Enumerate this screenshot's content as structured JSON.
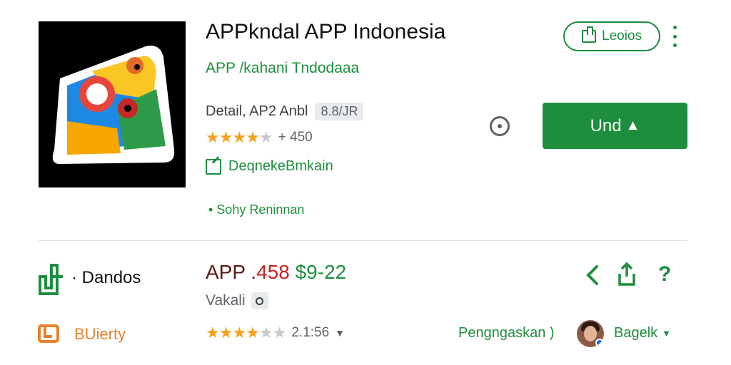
{
  "app": {
    "title": "APPkndal  APP Indonesia",
    "developer": "APP /kahani Tndodaaa",
    "meta_text": "Detail, AP2 Anbl",
    "meta_chip": "8.8/JR",
    "rating_count": "+ 450",
    "wishlist_label": "DeqnekeBmkain",
    "bullet_text": "• Sohy Reninnan",
    "stars_filled": 3.5
  },
  "actions": {
    "library_label": "Leoios",
    "install_label": "Und",
    "install_arrow": "▲"
  },
  "bottom": {
    "brand_label": "· Dandos",
    "library_label": "BUierty",
    "price_a": "APP .",
    "price_b": "458 ",
    "price_c": "$9-22",
    "variant_label": "Vakali",
    "rating_count": "2.1:56",
    "review_label": "Pengngaskan )",
    "account_label": "Bagelk",
    "help_glyph": "?"
  },
  "colors": {
    "brand_green": "#1e8e3e",
    "star_orange": "#f4a11d",
    "accent_orange": "#e8812b"
  },
  "icons": [
    "app-logo-icon",
    "library-icon",
    "more-vert-icon",
    "info-icon",
    "download-arrow-icon",
    "wishlist-icon",
    "brand-icon",
    "shopping-icon",
    "back-icon",
    "share-icon",
    "help-icon",
    "avatar"
  ]
}
